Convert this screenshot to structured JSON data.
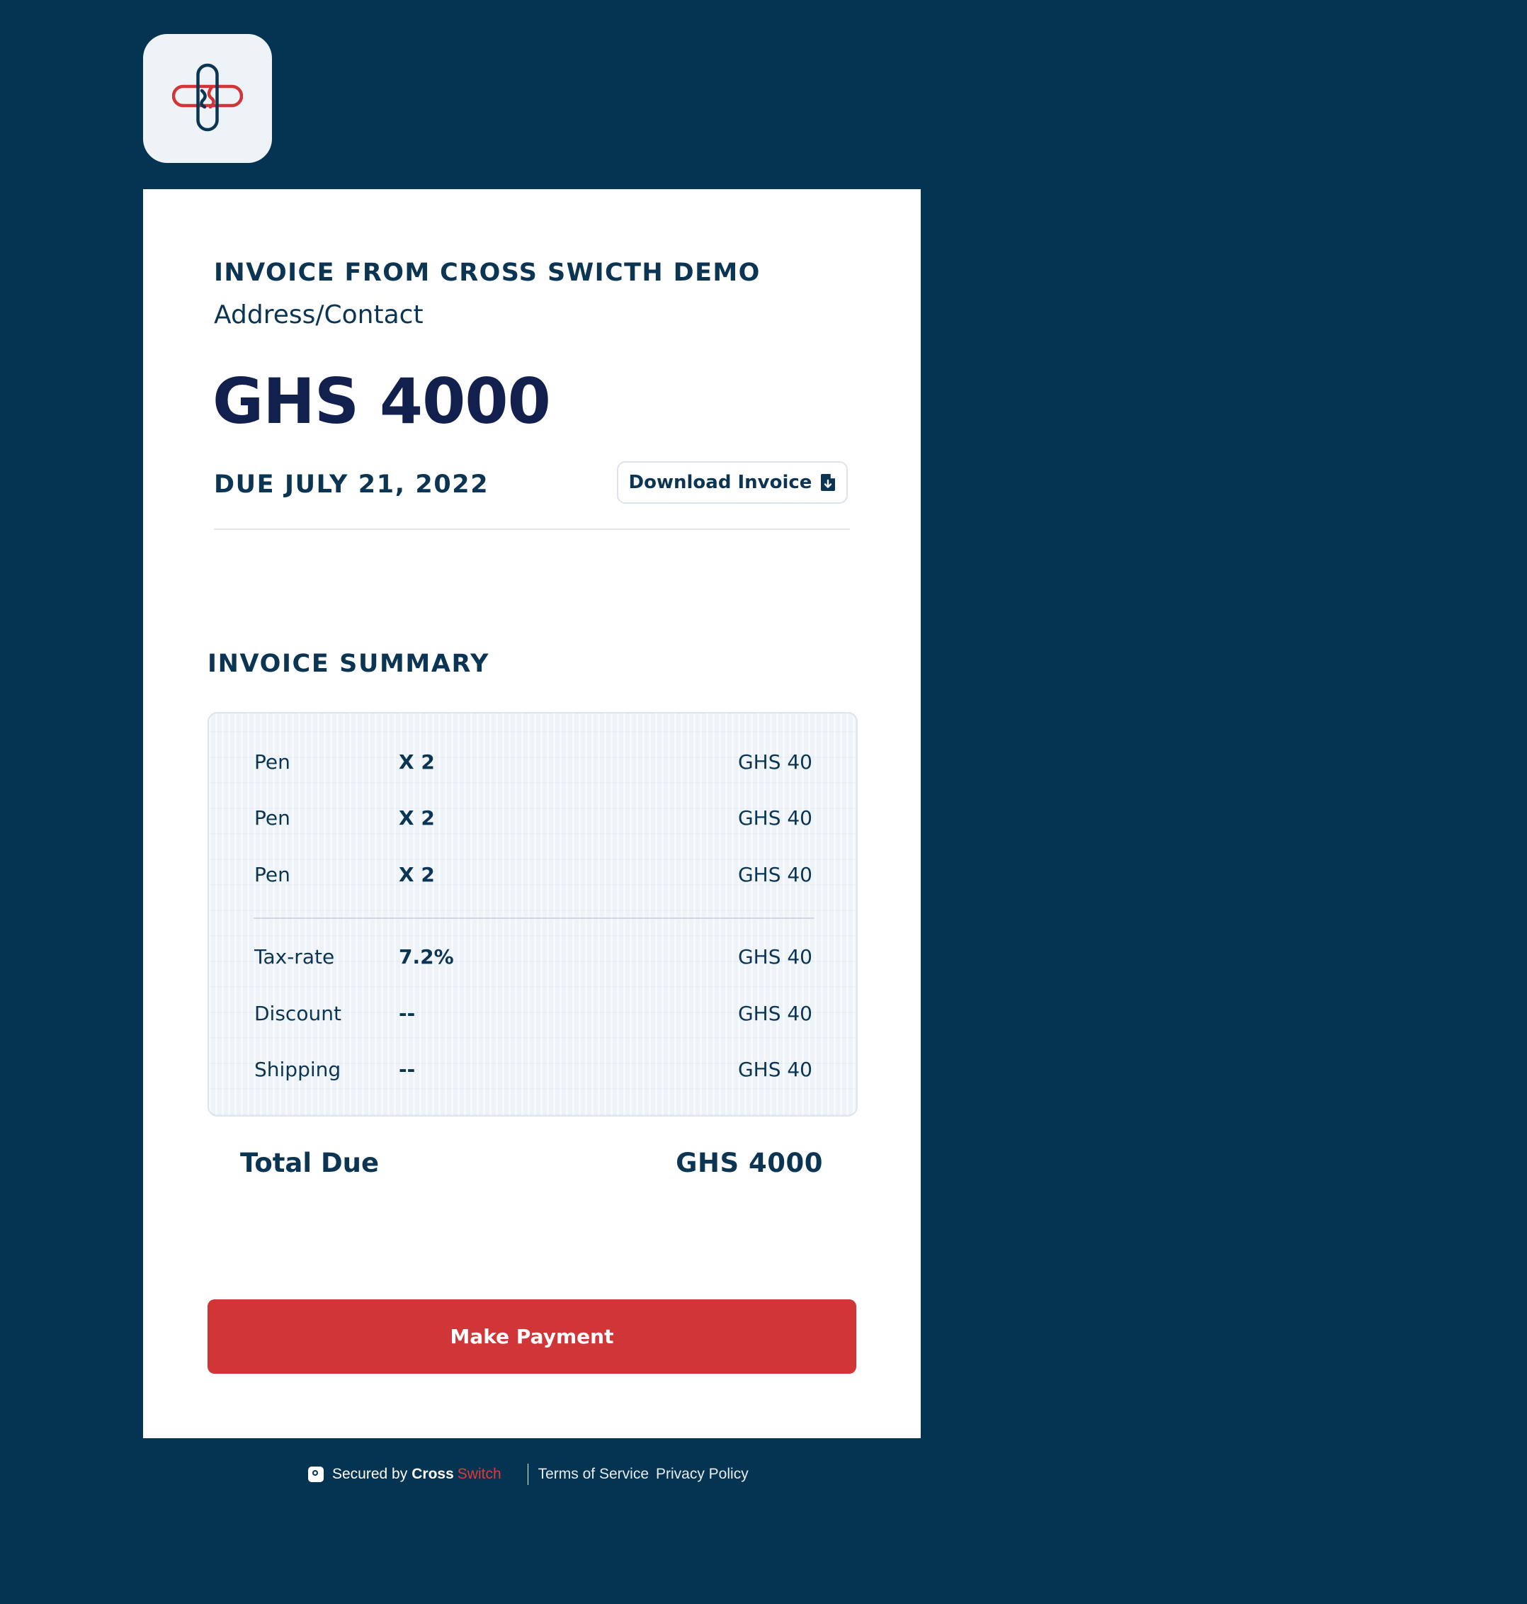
{
  "invoice": {
    "from_title": "INVOICE FROM CROSS SWICTH DEMO",
    "address": "Address/Contact",
    "amount": "GHS 4000",
    "due": "DUE JULY 21, 2022",
    "download_label": "Download Invoice"
  },
  "summary": {
    "heading": "INVOICE SUMMARY",
    "items": [
      {
        "name": "Pen",
        "qty": "X 2",
        "amount": "GHS 40"
      },
      {
        "name": "Pen",
        "qty": "X 2",
        "amount": "GHS 40"
      },
      {
        "name": "Pen",
        "qty": "X 2",
        "amount": "GHS 40"
      }
    ],
    "extras": [
      {
        "name": "Tax-rate",
        "value": "7.2%",
        "amount": "GHS 40"
      },
      {
        "name": "Discount",
        "value": "--",
        "amount": "GHS 40"
      },
      {
        "name": "Shipping",
        "value": "--",
        "amount": "GHS 40"
      }
    ],
    "total_label": "Total Due",
    "total_value": "GHS 4000"
  },
  "actions": {
    "pay_label": "Make Payment"
  },
  "footer": {
    "secured_by": "Secured by",
    "brand_cross": "Cross",
    "brand_switch": "Switch",
    "terms": "Terms of Service",
    "privacy": "Privacy Policy"
  },
  "colors": {
    "background": "#043451",
    "accent_red": "#d03537",
    "text_navy": "#0b3552"
  },
  "icons": {
    "logo": "cross-switch-logo-icon",
    "download": "file-download-icon",
    "shield": "secure-shield-icon"
  }
}
